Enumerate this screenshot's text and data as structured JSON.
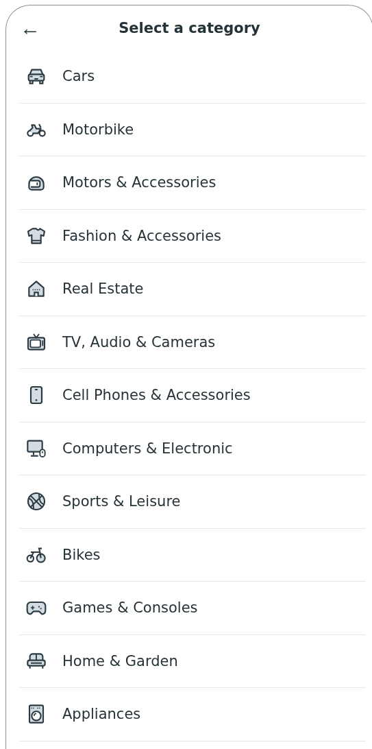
{
  "header": {
    "back": "←",
    "title": "Select a category"
  },
  "categories": [
    {
      "label": "Cars"
    },
    {
      "label": "Motorbike"
    },
    {
      "label": "Motors & Accessories"
    },
    {
      "label": "Fashion & Accessories"
    },
    {
      "label": "Real Estate"
    },
    {
      "label": "TV, Audio & Cameras"
    },
    {
      "label": "Cell Phones & Accessories"
    },
    {
      "label": "Computers & Electronic"
    },
    {
      "label": "Sports & Leisure"
    },
    {
      "label": "Bikes"
    },
    {
      "label": "Games & Consoles"
    },
    {
      "label": "Home & Garden"
    },
    {
      "label": "Appliances"
    }
  ]
}
